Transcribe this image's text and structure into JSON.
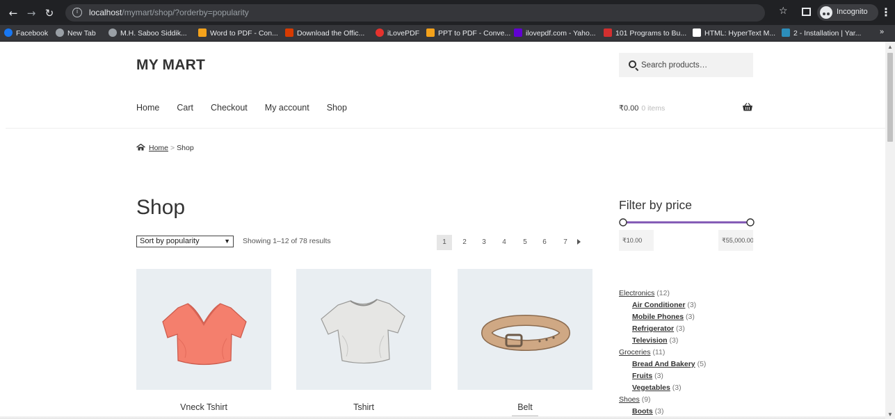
{
  "browser": {
    "url_host": "localhost",
    "url_path": "/mymart/shop/?orderby=popularity",
    "incognito_label": "Incognito",
    "bookmarks": [
      {
        "label": "Facebook",
        "icon_color": "#1877f2"
      },
      {
        "label": "New Tab",
        "icon_color": "#9aa0a6"
      },
      {
        "label": "M.H. Saboo Siddik...",
        "icon_color": "#9aa0a6"
      },
      {
        "label": "Word to PDF - Con...",
        "icon_color": "#f4a21b"
      },
      {
        "label": "Download the Offic...",
        "icon_color": "#d83b01"
      },
      {
        "label": "iLovePDF",
        "icon_color": "#e5322d"
      },
      {
        "label": "PPT to PDF - Conve...",
        "icon_color": "#f4a21b"
      },
      {
        "label": "ilovepdf.com - Yaho...",
        "icon_color": "#6001d2"
      },
      {
        "label": "101 Programs to Bu...",
        "icon_color": "#d32f2f"
      },
      {
        "label": "HTML: HyperText M...",
        "icon_color": "#ffffff"
      },
      {
        "label": "2 - Installation | Yar...",
        "icon_color": "#2c8ebb"
      }
    ],
    "more_bookmarks": "»"
  },
  "site": {
    "title": "MY MART",
    "search_placeholder": "Search products…",
    "nav": [
      "Home",
      "Cart",
      "Checkout",
      "My account",
      "Shop"
    ],
    "cart_total": "₹0.00",
    "cart_count": "0 items"
  },
  "breadcrumb": {
    "home": "Home",
    "separator": ">",
    "current": "Shop"
  },
  "shop": {
    "title": "Shop",
    "orderby_selected": "Sort by popularity",
    "result_count": "Showing 1–12 of 78 results",
    "pages": [
      "1",
      "2",
      "3",
      "4",
      "5",
      "6",
      "7"
    ],
    "current_page": "1",
    "products": [
      {
        "name": "Vneck Tshirt",
        "icon": "vneck-tshirt-image",
        "color": "#f07e6e"
      },
      {
        "name": "Tshirt",
        "icon": "tshirt-image",
        "color": "#e4e4e2"
      },
      {
        "name": "Belt",
        "icon": "belt-image",
        "color": "#caa27f"
      }
    ]
  },
  "sidebar": {
    "filter_title": "Filter by price",
    "min_price": "₹10.00",
    "max_price": "₹55,000.00",
    "slider_color": "#7f54b3",
    "categories": [
      {
        "name": "Electronics",
        "count": "(12)",
        "level": 0
      },
      {
        "name": "Air Conditioner",
        "count": "(3)",
        "level": 1
      },
      {
        "name": "Mobile Phones",
        "count": "(3)",
        "level": 1
      },
      {
        "name": "Refrigerator",
        "count": "(3)",
        "level": 1
      },
      {
        "name": "Television",
        "count": "(3)",
        "level": 1
      },
      {
        "name": "Groceries",
        "count": "(11)",
        "level": 0
      },
      {
        "name": "Bread And Bakery",
        "count": "(5)",
        "level": 1
      },
      {
        "name": "Fruits",
        "count": "(3)",
        "level": 1
      },
      {
        "name": "Vegetables",
        "count": "(3)",
        "level": 1
      },
      {
        "name": "Shoes",
        "count": "(9)",
        "level": 0
      },
      {
        "name": "Boots",
        "count": "(3)",
        "level": 1
      }
    ]
  }
}
